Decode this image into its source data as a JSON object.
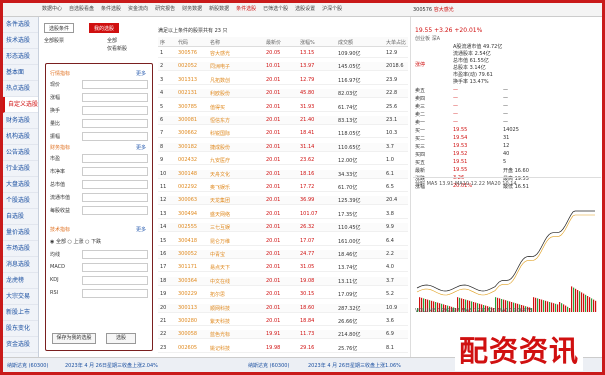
{
  "menu": [
    "数据中心",
    "自选股看盘",
    "条件选股",
    "资金流向",
    "研究报告",
    "财务数据",
    "新股数据",
    "条件选股",
    "已筛选个股",
    "选股设置",
    "沪深个股"
  ],
  "menu_active_index": 7,
  "stock_header": {
    "code": "300576",
    "name": "容大感光"
  },
  "sidebar": [
    "条件选股",
    "技术选股",
    "形态选股",
    "基本面",
    "热点选股",
    "自定义选股",
    "财务选股",
    "机构选股",
    "公告选股",
    "行业选股",
    "大盘选股",
    "个股选股",
    "自选股",
    "量价选股",
    "市场选股",
    "消息选股",
    "龙虎榜",
    "大宗交易",
    "新股上市",
    "股东变化",
    "资金选股"
  ],
  "sidebar_selected": 5,
  "panel": {
    "seg_a": "选股条件",
    "seg_b": "我的选股",
    "opt_a": "全部",
    "opt_b": "全部股票",
    "opt_c": "仅看新股",
    "sec1": "行情指标",
    "sec2": "财务指标",
    "sec3": "技术指标",
    "more": "更多",
    "fields1": [
      "现价",
      "涨幅",
      "换手",
      "量比",
      "振幅"
    ],
    "fields2": [
      "市盈",
      "市净率",
      "总市值",
      "流通市值",
      "每股收益"
    ],
    "fields3": [
      "均线",
      "MACD",
      "KDJ",
      "RSI"
    ],
    "radio": [
      "全部",
      "上涨",
      "下跌"
    ],
    "btn_a": "保存为我的选股",
    "btn_b": "选股"
  },
  "table": {
    "title": "满足以上条件的股票共有 23 只",
    "headers": [
      "序",
      "代码",
      "名称",
      "最新价",
      "涨幅%",
      "成交额",
      "大单占比"
    ],
    "rows": [
      [
        "1",
        "300576",
        "容大感光",
        "20.05",
        "13.15",
        "109.90亿",
        "12.9"
      ],
      [
        "2",
        "002052",
        "同洲电子",
        "10.01",
        "13.97",
        "145.05亿",
        "2018.6"
      ],
      [
        "3",
        "301313",
        "凡拓数创",
        "20.01",
        "12.79",
        "116.97亿",
        "23.9"
      ],
      [
        "4",
        "002131",
        "利欧股份",
        "20.01",
        "45.80",
        "82.03亿",
        "22.8"
      ],
      [
        "5",
        "300785",
        "值得买",
        "20.01",
        "31.93",
        "61.74亿",
        "25.6"
      ],
      [
        "6",
        "300081",
        "恒信东方",
        "20.01",
        "21.40",
        "83.13亿",
        "23.1"
      ],
      [
        "7",
        "300662",
        "科锐国际",
        "20.01",
        "18.41",
        "118.05亿",
        "10.3"
      ],
      [
        "8",
        "300182",
        "捷成股份",
        "20.01",
        "31.14",
        "110.65亿",
        "3.7"
      ],
      [
        "9",
        "002432",
        "九安医疗",
        "20.01",
        "23.62",
        "12.00亿",
        "1.0"
      ],
      [
        "10",
        "300148",
        "天舟文化",
        "20.01",
        "18.16",
        "34.33亿",
        "6.1"
      ],
      [
        "11",
        "002292",
        "奥飞娱乐",
        "20.01",
        "17.72",
        "61.70亿",
        "6.5"
      ],
      [
        "12",
        "300063",
        "天龙集团",
        "20.01",
        "36.99",
        "125.39亿",
        "20.4"
      ],
      [
        "13",
        "300494",
        "盛天网络",
        "20.01",
        "101.07",
        "17.35亿",
        "3.8"
      ],
      [
        "14",
        "002555",
        "三七互娱",
        "20.01",
        "26.32",
        "110.45亿",
        "9.9"
      ],
      [
        "15",
        "300418",
        "昆仑万维",
        "20.01",
        "17.07",
        "161.00亿",
        "6.4"
      ],
      [
        "16",
        "300052",
        "中青宝",
        "20.01",
        "24.77",
        "18.46亿",
        "2.2"
      ],
      [
        "17",
        "301171",
        "易点天下",
        "20.01",
        "31.05",
        "13.74亿",
        "4.0"
      ],
      [
        "18",
        "300364",
        "中文在线",
        "20.01",
        "19.08",
        "13.11亿",
        "3.7"
      ],
      [
        "19",
        "300229",
        "拓尔思",
        "20.01",
        "30.15",
        "17.09亿",
        "5.2"
      ],
      [
        "20",
        "300113",
        "顺网科技",
        "20.01",
        "18.60",
        "287.32亿",
        "10.9"
      ],
      [
        "21",
        "300280",
        "紫天科技",
        "20.01",
        "18.84",
        "26.66亿",
        "3.6"
      ],
      [
        "22",
        "300058",
        "蓝色光标",
        "19.91",
        "11.73",
        "214.80亿",
        "6.9"
      ],
      [
        "23",
        "002605",
        "姚记科技",
        "19.98",
        "29.16",
        "25.76亿",
        "8.1"
      ]
    ]
  },
  "quote": {
    "price": "19.55",
    "change": "+3.26 +20.01%",
    "sub": "创业板 深A",
    "badge": "涨停",
    "info": [
      "A股流通市值 49.72亿",
      "流通股本 2.54亿",
      "总市值 61.55亿",
      "总股本 3.14亿",
      "市盈率(动) 79.61",
      "换手率 13.47%"
    ],
    "orderbook": [
      [
        "卖五",
        "—",
        "—"
      ],
      [
        "卖四",
        "—",
        "—"
      ],
      [
        "卖三",
        "—",
        "—"
      ],
      [
        "卖二",
        "—",
        "—"
      ],
      [
        "卖一",
        "—",
        "—"
      ],
      [
        "买一",
        "19.55",
        "14025"
      ],
      [
        "买二",
        "19.54",
        "31"
      ],
      [
        "买三",
        "19.53",
        "12"
      ],
      [
        "买四",
        "19.52",
        "40"
      ],
      [
        "买五",
        "19.51",
        "5"
      ],
      [
        "最新",
        "19.55",
        "开盘 16.60"
      ],
      [
        "涨跌",
        "3.26",
        "最高 19.55"
      ],
      [
        "涨幅",
        "20.01%",
        "最低 16.51"
      ]
    ],
    "chart_legend": "分时 MA5 13.91 MA10 12.22 MA20 10.14",
    "volume_legend": "VOLUME 1999397 MA5 1231720 MA10 906475",
    "red": "#d01010",
    "green": "#2aa03a"
  },
  "status": [
    "纳斯达克 (60300)",
    "2023年 4 月 26日星期三收盘上涨2.04%",
    "纳斯达克 (60300)",
    "2023年 4 月 26日星期三收盘上涨1.06%"
  ],
  "watermark": "配资资讯"
}
